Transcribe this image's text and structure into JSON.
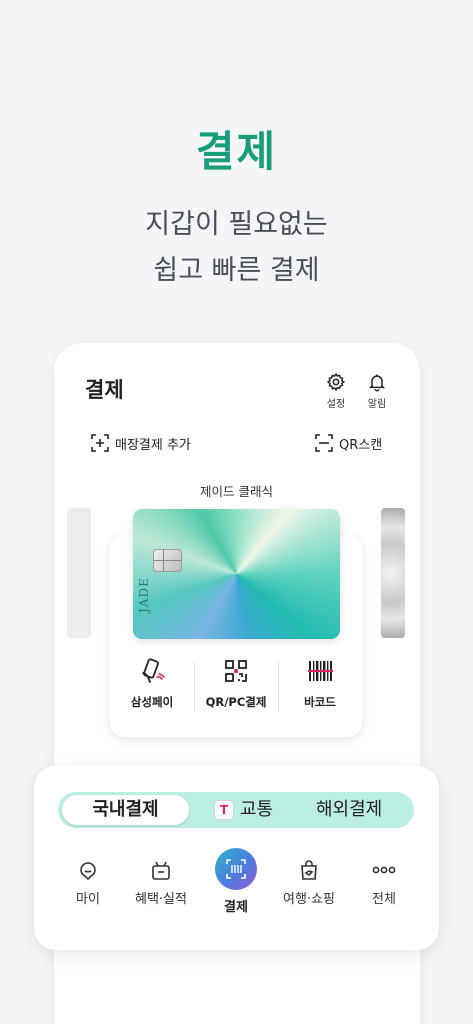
{
  "hero": {
    "title": "결제",
    "subtitle_line1": "지갑이 필요없는",
    "subtitle_line2": "쉽고 빠른 결제"
  },
  "header": {
    "title": "결제",
    "settings_label": "설정",
    "alarm_label": "알림"
  },
  "actions": {
    "add_store_payment": "매장결제 추가",
    "qr_scan": "QR스캔"
  },
  "card": {
    "name": "제이드 클래식",
    "brand": "JADE"
  },
  "payment_methods": [
    {
      "label": "삼성페이",
      "icon": "samsung-pay-icon"
    },
    {
      "label": "QR/PC결제",
      "icon": "qr-code-icon"
    },
    {
      "label": "바코드",
      "icon": "barcode-icon"
    }
  ],
  "segments": {
    "domestic": "국내결제",
    "transit_badge": "T",
    "transit": "교통",
    "overseas": "해외결제",
    "selected": "국내결제"
  },
  "bottom_nav": [
    {
      "label": "마이",
      "icon": "my-icon"
    },
    {
      "label": "혜택·실적",
      "icon": "gift-icon"
    },
    {
      "label": "결제",
      "icon": "pay-icon",
      "active": true
    },
    {
      "label": "여행·쇼핑",
      "icon": "shopping-bag-icon"
    },
    {
      "label": "전체",
      "icon": "more-icon"
    }
  ],
  "colors": {
    "accent": "#1a9e78",
    "segment_bg": "#bdeee4",
    "transit_t": "#e0245e"
  }
}
